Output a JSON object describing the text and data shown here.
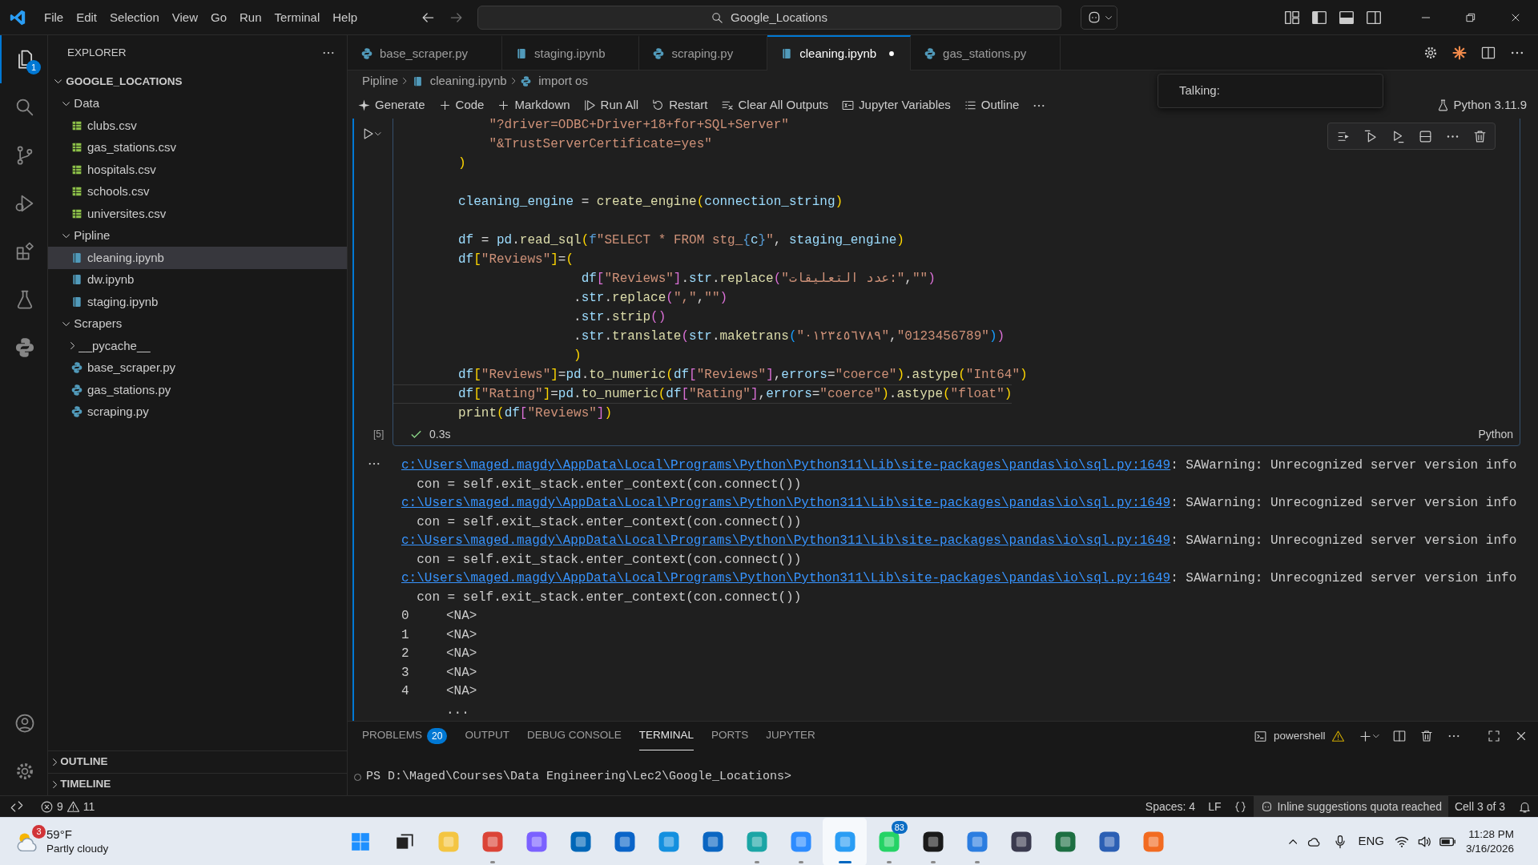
{
  "title_bar": {
    "menus": [
      "File",
      "Edit",
      "Selection",
      "View",
      "Go",
      "Run",
      "Terminal",
      "Help"
    ],
    "search": "Google_Locations"
  },
  "activity_bar": {
    "items": [
      {
        "kind": "explorer",
        "selected": true,
        "badge": "1"
      },
      {
        "kind": "search",
        "selected": false
      },
      {
        "kind": "source-control",
        "selected": false
      },
      {
        "kind": "run-debug",
        "selected": false
      },
      {
        "kind": "extensions",
        "selected": false
      },
      {
        "kind": "testing",
        "selected": false
      },
      {
        "kind": "python",
        "selected": false
      }
    ],
    "bottom": [
      {
        "kind": "account"
      },
      {
        "kind": "settings"
      }
    ]
  },
  "explorer": {
    "title": "EXPLORER",
    "root": {
      "label": "GOOGLE_LOCATIONS",
      "expanded": true
    },
    "tree": [
      {
        "kind": "folder",
        "label": "Data",
        "expanded": true,
        "selected": false,
        "children": [
          {
            "kind": "csv",
            "label": "clubs.csv",
            "selected": false
          },
          {
            "kind": "csv",
            "label": "gas_stations.csv",
            "selected": false
          },
          {
            "kind": "csv",
            "label": "hospitals.csv",
            "selected": false
          },
          {
            "kind": "csv",
            "label": "schools.csv",
            "selected": false
          },
          {
            "kind": "csv",
            "label": "universites.csv",
            "selected": false
          }
        ]
      },
      {
        "kind": "folder",
        "label": "Pipline",
        "expanded": true,
        "selected": false,
        "children": [
          {
            "kind": "notebook",
            "label": "cleaning.ipynb",
            "selected": true
          },
          {
            "kind": "notebook",
            "label": "dw.ipynb",
            "selected": false
          },
          {
            "kind": "notebook",
            "label": "staging.ipynb",
            "selected": false
          }
        ]
      },
      {
        "kind": "folder",
        "label": "Scrapers",
        "expanded": true,
        "selected": false,
        "children": [
          {
            "kind": "folder",
            "label": "__pycache__",
            "expanded": false,
            "selected": false
          },
          {
            "kind": "python",
            "label": "base_scraper.py",
            "selected": false
          },
          {
            "kind": "python",
            "label": "gas_stations.py",
            "selected": false
          },
          {
            "kind": "python",
            "label": "scraping.py",
            "selected": false
          }
        ]
      }
    ],
    "sections": [
      {
        "label": "OUTLINE",
        "expanded": false
      },
      {
        "label": "TIMELINE",
        "expanded": false
      }
    ]
  },
  "tabs": [
    {
      "label": "base_scraper.py",
      "kind": "python",
      "selected": false,
      "modified": false
    },
    {
      "label": "staging.ipynb",
      "kind": "notebook",
      "selected": false,
      "modified": false
    },
    {
      "label": "scraping.py",
      "kind": "python",
      "selected": false,
      "modified": false
    },
    {
      "label": "cleaning.ipynb",
      "kind": "notebook",
      "selected": true,
      "modified": true
    },
    {
      "label": "gas_stations.py",
      "kind": "python",
      "selected": false,
      "modified": false
    }
  ],
  "breadcrumbs": [
    {
      "label": "Pipline",
      "kind": "folder"
    },
    {
      "label": "cleaning.ipynb",
      "kind": "notebook"
    },
    {
      "label": "import os",
      "kind": "python"
    }
  ],
  "notebook_toolbar": {
    "actions": [
      {
        "label": "Generate",
        "kind": "sparkle"
      },
      {
        "label": "Code",
        "kind": "plus"
      },
      {
        "label": "Markdown",
        "kind": "plus"
      },
      {
        "label": "Run All",
        "kind": "run-all"
      },
      {
        "label": "Restart",
        "kind": "restart"
      },
      {
        "label": "Clear All Outputs",
        "kind": "clear"
      },
      {
        "label": "Jupyter Variables",
        "kind": "variables"
      },
      {
        "label": "Outline",
        "kind": "outline"
      }
    ],
    "kernel": "Python 3.11.9"
  },
  "chat_popup": {
    "label": "Talking:"
  },
  "cell": {
    "execution_count": "[5]",
    "duration": "0.3s",
    "language": "Python",
    "lines": [
      {
        "kind": "code",
        "current": false,
        "segments": [
          {
            "kind": "string",
            "text": "    \"?driver=ODBC+Driver+18+for+SQL+Server\""
          }
        ]
      },
      {
        "kind": "code",
        "current": false,
        "segments": [
          {
            "kind": "string",
            "text": "    \"&TrustServerCertificate=yes\""
          }
        ]
      },
      {
        "kind": "code",
        "current": false,
        "segments": [
          {
            "kind": "bracket1",
            "text": ")"
          }
        ]
      },
      {
        "kind": "blank",
        "current": false
      },
      {
        "kind": "code",
        "current": false,
        "segments": [
          {
            "kind": "variable",
            "text": "cleaning_engine"
          },
          {
            "kind": "plain",
            "text": " = "
          },
          {
            "kind": "function",
            "text": "create_engine"
          },
          {
            "kind": "bracket1",
            "text": "("
          },
          {
            "kind": "variable",
            "text": "connection_string"
          },
          {
            "kind": "bracket1",
            "text": ")"
          }
        ]
      },
      {
        "kind": "blank",
        "current": false
      },
      {
        "kind": "code",
        "current": false,
        "segments": [
          {
            "kind": "variable",
            "text": "df"
          },
          {
            "kind": "plain",
            "text": " = "
          },
          {
            "kind": "variable",
            "text": "pd"
          },
          {
            "kind": "plain",
            "text": "."
          },
          {
            "kind": "function",
            "text": "read_sql"
          },
          {
            "kind": "bracket1",
            "text": "("
          },
          {
            "kind": "keyword",
            "text": "f"
          },
          {
            "kind": "string",
            "text": "\"SELECT * FROM stg_"
          },
          {
            "kind": "keyword",
            "text": "{"
          },
          {
            "kind": "variable",
            "text": "c"
          },
          {
            "kind": "keyword",
            "text": "}"
          },
          {
            "kind": "string",
            "text": "\""
          },
          {
            "kind": "plain",
            "text": ", "
          },
          {
            "kind": "variable",
            "text": "staging_engine"
          },
          {
            "kind": "bracket1",
            "text": ")"
          }
        ]
      },
      {
        "kind": "code",
        "current": false,
        "segments": [
          {
            "kind": "variable",
            "text": "df"
          },
          {
            "kind": "bracket1",
            "text": "["
          },
          {
            "kind": "string",
            "text": "\"Reviews\""
          },
          {
            "kind": "bracket1",
            "text": "]"
          },
          {
            "kind": "plain",
            "text": "="
          },
          {
            "kind": "bracket1",
            "text": "("
          }
        ]
      },
      {
        "kind": "code",
        "current": false,
        "segments": [
          {
            "kind": "variable",
            "text": "                df"
          },
          {
            "kind": "bracket2",
            "text": "["
          },
          {
            "kind": "string",
            "text": "\"Reviews\""
          },
          {
            "kind": "bracket2",
            "text": "]"
          },
          {
            "kind": "plain",
            "text": "."
          },
          {
            "kind": "variable",
            "text": "str"
          },
          {
            "kind": "plain",
            "text": "."
          },
          {
            "kind": "function",
            "text": "replace"
          },
          {
            "kind": "bracket2",
            "text": "("
          },
          {
            "kind": "string",
            "text": "\"عدد التعليقات:\""
          },
          {
            "kind": "plain",
            "text": ","
          },
          {
            "kind": "string",
            "text": "\"\""
          },
          {
            "kind": "bracket2",
            "text": ")"
          }
        ]
      },
      {
        "kind": "code",
        "current": false,
        "segments": [
          {
            "kind": "plain",
            "text": "               ."
          },
          {
            "kind": "variable",
            "text": "str"
          },
          {
            "kind": "plain",
            "text": "."
          },
          {
            "kind": "function",
            "text": "replace"
          },
          {
            "kind": "bracket2",
            "text": "("
          },
          {
            "kind": "string",
            "text": "\",\""
          },
          {
            "kind": "plain",
            "text": ","
          },
          {
            "kind": "string",
            "text": "\"\""
          },
          {
            "kind": "bracket2",
            "text": ")"
          }
        ]
      },
      {
        "kind": "code",
        "current": false,
        "segments": [
          {
            "kind": "plain",
            "text": "               ."
          },
          {
            "kind": "variable",
            "text": "str"
          },
          {
            "kind": "plain",
            "text": "."
          },
          {
            "kind": "function",
            "text": "strip"
          },
          {
            "kind": "bracket2",
            "text": "()"
          }
        ]
      },
      {
        "kind": "code",
        "current": false,
        "segments": [
          {
            "kind": "plain",
            "text": "               ."
          },
          {
            "kind": "variable",
            "text": "str"
          },
          {
            "kind": "plain",
            "text": "."
          },
          {
            "kind": "function",
            "text": "translate"
          },
          {
            "kind": "bracket2",
            "text": "("
          },
          {
            "kind": "variable",
            "text": "str"
          },
          {
            "kind": "plain",
            "text": "."
          },
          {
            "kind": "function",
            "text": "maketrans"
          },
          {
            "kind": "bracket3",
            "text": "("
          },
          {
            "kind": "string",
            "text": "\"٠١٢٣٤٥٦٧٨٩\""
          },
          {
            "kind": "plain",
            "text": ","
          },
          {
            "kind": "string",
            "text": "\"0123456789\""
          },
          {
            "kind": "bracket3",
            "text": ")"
          },
          {
            "kind": "bracket2",
            "text": ")"
          }
        ]
      },
      {
        "kind": "code",
        "current": false,
        "segments": [
          {
            "kind": "bracket1",
            "text": "               )"
          }
        ]
      },
      {
        "kind": "code",
        "current": false,
        "segments": [
          {
            "kind": "variable",
            "text": "df"
          },
          {
            "kind": "bracket1",
            "text": "["
          },
          {
            "kind": "string",
            "text": "\"Reviews\""
          },
          {
            "kind": "bracket1",
            "text": "]"
          },
          {
            "kind": "plain",
            "text": "="
          },
          {
            "kind": "variable",
            "text": "pd"
          },
          {
            "kind": "plain",
            "text": "."
          },
          {
            "kind": "function",
            "text": "to_numeric"
          },
          {
            "kind": "bracket1",
            "text": "("
          },
          {
            "kind": "variable",
            "text": "df"
          },
          {
            "kind": "bracket2",
            "text": "["
          },
          {
            "kind": "string",
            "text": "\"Reviews\""
          },
          {
            "kind": "bracket2",
            "text": "]"
          },
          {
            "kind": "plain",
            "text": ","
          },
          {
            "kind": "variable",
            "text": "errors"
          },
          {
            "kind": "plain",
            "text": "="
          },
          {
            "kind": "string",
            "text": "\"coerce\""
          },
          {
            "kind": "bracket1",
            "text": ")"
          },
          {
            "kind": "plain",
            "text": "."
          },
          {
            "kind": "function",
            "text": "astype"
          },
          {
            "kind": "bracket1",
            "text": "("
          },
          {
            "kind": "string",
            "text": "\"Int64\""
          },
          {
            "kind": "bracket1",
            "text": ")"
          }
        ]
      },
      {
        "kind": "code",
        "current": true,
        "segments": [
          {
            "kind": "variable",
            "text": "df"
          },
          {
            "kind": "bracket1",
            "text": "["
          },
          {
            "kind": "string",
            "text": "\"Rating\""
          },
          {
            "kind": "bracket1",
            "text": "]"
          },
          {
            "kind": "plain",
            "text": "="
          },
          {
            "kind": "variable",
            "text": "pd"
          },
          {
            "kind": "plain",
            "text": "."
          },
          {
            "kind": "function",
            "text": "to_numeric"
          },
          {
            "kind": "bracket1",
            "text": "("
          },
          {
            "kind": "variable",
            "text": "df"
          },
          {
            "kind": "bracket2",
            "text": "["
          },
          {
            "kind": "string",
            "text": "\"Rating\""
          },
          {
            "kind": "bracket2",
            "text": "]"
          },
          {
            "kind": "plain",
            "text": ","
          },
          {
            "kind": "variable",
            "text": "errors"
          },
          {
            "kind": "plain",
            "text": "="
          },
          {
            "kind": "string",
            "text": "\"coerce\""
          },
          {
            "kind": "bracket1",
            "text": ")"
          },
          {
            "kind": "plain",
            "text": "."
          },
          {
            "kind": "function",
            "text": "astype"
          },
          {
            "kind": "bracket1",
            "text": "("
          },
          {
            "kind": "string",
            "text": "\"float\""
          },
          {
            "kind": "bracket1",
            "text": ")"
          }
        ]
      },
      {
        "kind": "code",
        "current": false,
        "segments": [
          {
            "kind": "function",
            "text": "print"
          },
          {
            "kind": "bracket1",
            "text": "("
          },
          {
            "kind": "variable",
            "text": "df"
          },
          {
            "kind": "bracket2",
            "text": "["
          },
          {
            "kind": "string",
            "text": "\"Reviews\""
          },
          {
            "kind": "bracket2",
            "text": "]"
          },
          {
            "kind": "bracket1",
            "text": ")"
          }
        ]
      }
    ]
  },
  "output": {
    "warnings": [
      {
        "path": "c:\\Users\\maged.magdy\\AppData\\Local\\Programs\\Python\\Python311\\Lib\\site-packages\\pandas\\io\\sql.py:1649",
        "message": ": SAWarning: Unrecognized server version info",
        "source": "  con = self.exit_stack.enter_context(con.connect())"
      },
      {
        "path": "c:\\Users\\maged.magdy\\AppData\\Local\\Programs\\Python\\Python311\\Lib\\site-packages\\pandas\\io\\sql.py:1649",
        "message": ": SAWarning: Unrecognized server version info",
        "source": "  con = self.exit_stack.enter_context(con.connect())"
      },
      {
        "path": "c:\\Users\\maged.magdy\\AppData\\Local\\Programs\\Python\\Python311\\Lib\\site-packages\\pandas\\io\\sql.py:1649",
        "message": ": SAWarning: Unrecognized server version info",
        "source": "  con = self.exit_stack.enter_context(con.connect())"
      },
      {
        "path": "c:\\Users\\maged.magdy\\AppData\\Local\\Programs\\Python\\Python311\\Lib\\site-packages\\pandas\\io\\sql.py:1649",
        "message": ": SAWarning: Unrecognized server version info",
        "source": "  con = self.exit_stack.enter_context(con.connect())"
      }
    ],
    "series": [
      {
        "index": "0",
        "value": "<NA>"
      },
      {
        "index": "1",
        "value": "<NA>"
      },
      {
        "index": "2",
        "value": "<NA>"
      },
      {
        "index": "3",
        "value": "<NA>"
      },
      {
        "index": "4",
        "value": "<NA>"
      }
    ],
    "more": "..."
  },
  "panel": {
    "tabs": [
      {
        "label": "PROBLEMS",
        "badge": "20",
        "selected": false
      },
      {
        "label": "OUTPUT",
        "selected": false
      },
      {
        "label": "DEBUG CONSOLE",
        "selected": false
      },
      {
        "label": "TERMINAL",
        "selected": true
      },
      {
        "label": "PORTS",
        "selected": false
      },
      {
        "label": "JUPYTER",
        "selected": false
      }
    ],
    "terminal_name": "powershell",
    "prompt": "PS D:\\Maged\\Courses\\Data Engineering\\Lec2\\Google_Locations>"
  },
  "status_bar": {
    "errors": "9",
    "warnings": "11",
    "spaces": "Spaces: 4",
    "eol": "LF",
    "copilot": "Inline suggestions quota reached",
    "cell": "Cell 3 of 3"
  },
  "taskbar": {
    "weather": {
      "badge": "3",
      "temp": "59°F",
      "text": "Partly cloudy"
    },
    "apps": [
      {
        "color": "#f4c542",
        "running": false,
        "active": false
      },
      {
        "color": "#db4437",
        "running": true,
        "active": false
      },
      {
        "color": "#7b61ff",
        "running": false,
        "active": false
      },
      {
        "color": "#0067b8",
        "running": false,
        "active": false
      },
      {
        "color": "#0a64c8",
        "running": false,
        "active": false
      },
      {
        "color": "#1490df",
        "running": false,
        "active": false
      },
      {
        "color": "#0a66c2",
        "running": false,
        "active": false
      },
      {
        "color": "#1ba5a5",
        "running": true,
        "active": false
      },
      {
        "color": "#2d8cff",
        "running": true,
        "active": false
      },
      {
        "color": "#2a9df4",
        "running": true,
        "active": true
      },
      {
        "color": "#25d366",
        "running": true,
        "active": false,
        "badge": "83"
      },
      {
        "color": "#1a1a1a",
        "running": true,
        "active": false
      },
      {
        "color": "#2b7de0",
        "running": true,
        "active": false
      },
      {
        "color": "#3b3b4f",
        "running": false,
        "active": false
      },
      {
        "color": "#1d6f42",
        "running": false,
        "active": false
      },
      {
        "color": "#2b5fb4",
        "running": false,
        "active": false
      },
      {
        "color": "#f26b21",
        "running": false,
        "active": false
      }
    ],
    "language": "ENG",
    "time": "11:28 PM",
    "date": "3/16/2026"
  }
}
